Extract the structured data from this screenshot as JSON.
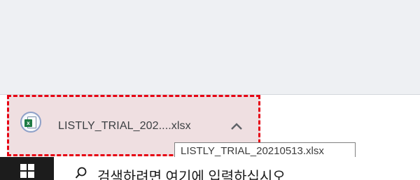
{
  "download": {
    "file_icon": "excel-file-icon",
    "file_name": "LISTLY_TRIAL_202....xlsx",
    "menu_icon": "chevron-up-icon"
  },
  "tooltip": {
    "text": "LISTLY_TRIAL_20210513.xlsx"
  },
  "taskbar": {
    "start_icon": "windows-logo-icon",
    "search_icon": "search-icon",
    "search_placeholder": "검색하려면 여기에 입력하십시오"
  },
  "colors": {
    "highlight_border": "#e60012",
    "highlight_fill": "#efdfe1",
    "excel_green": "#1e7b45",
    "taskbar_start": "#1c1c1c"
  }
}
